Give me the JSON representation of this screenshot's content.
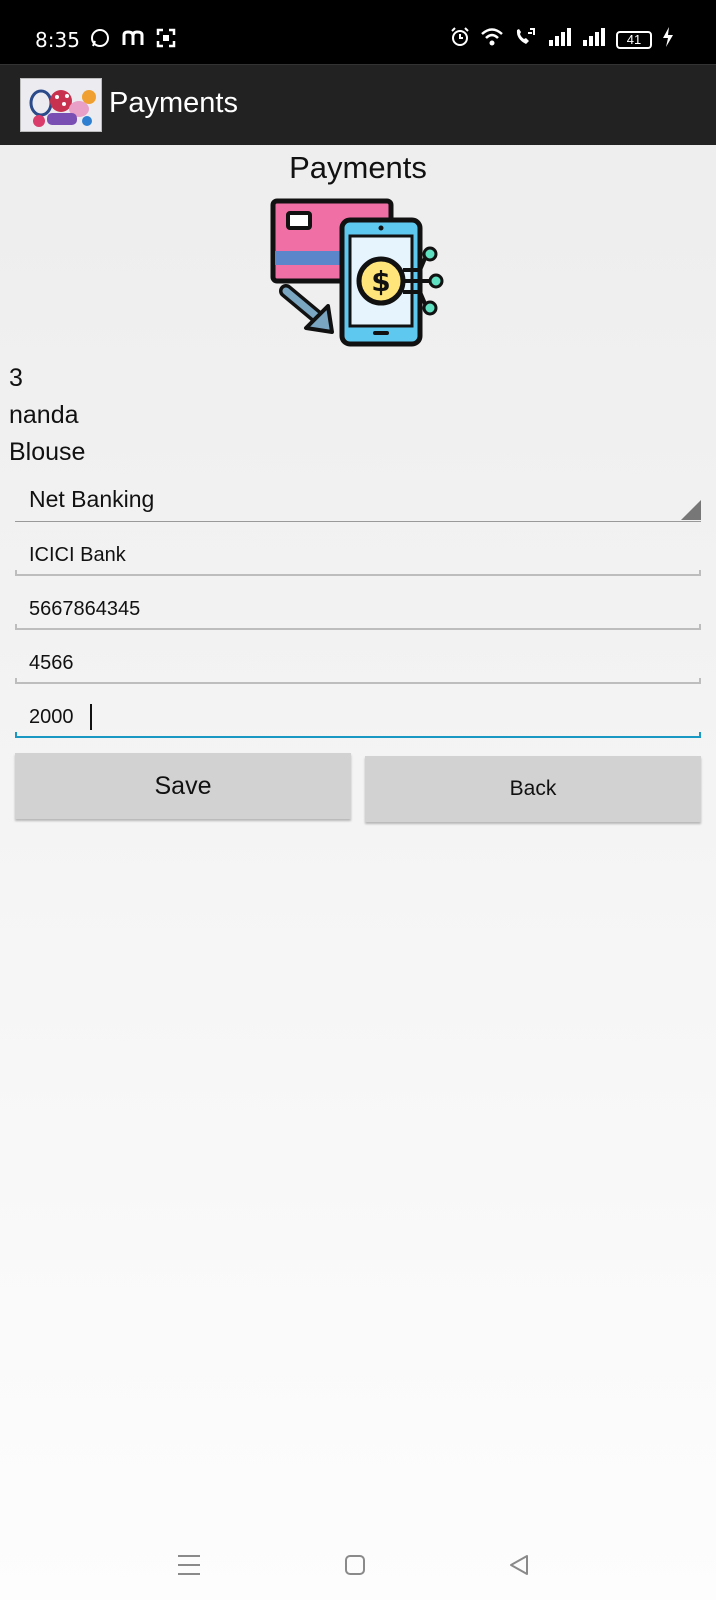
{
  "status_bar": {
    "time": "8:35",
    "battery": "41",
    "icons_left": [
      "whatsapp-icon",
      "m-app-icon",
      "scan-icon"
    ],
    "icons_right": [
      "alarm-icon",
      "wifi-icon",
      "volte-call-icon",
      "signal-icon",
      "signal-icon",
      "battery-icon",
      "charging-icon"
    ]
  },
  "app_bar": {
    "title": "Payments"
  },
  "page": {
    "heading": "Payments",
    "info": [
      "3",
      "nanda",
      "Blouse"
    ]
  },
  "form": {
    "payment_method": "Net Banking",
    "fields": [
      {
        "value": "ICICI Bank"
      },
      {
        "value": "5667864345"
      },
      {
        "value": "4566"
      },
      {
        "value": "2000"
      }
    ],
    "save_label": "Save",
    "back_label": "Back"
  },
  "colors": {
    "app_bar": "#222222",
    "status_bar": "#000000",
    "button": "#d2d2d2",
    "focus_accent": "#1a98c4",
    "card_pink": "#f06fa5",
    "card_stripe": "#5b86c9",
    "phone_blue": "#5fc8ef",
    "coin_yellow": "#ffe57a"
  },
  "nav_bar": {
    "icons": [
      "menu-icon",
      "home-icon",
      "back-icon"
    ]
  }
}
